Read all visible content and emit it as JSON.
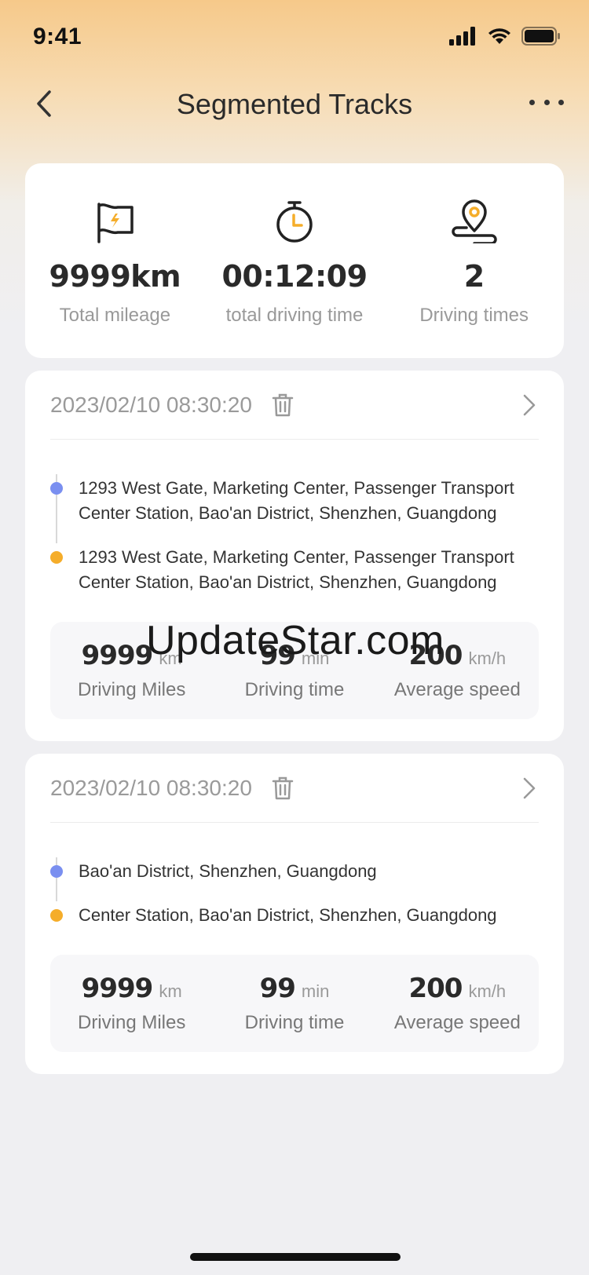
{
  "status": {
    "time": "9:41"
  },
  "nav": {
    "title": "Segmented Tracks"
  },
  "summary": [
    {
      "icon": "flag-icon",
      "value": "9999km",
      "label": "Total mileage"
    },
    {
      "icon": "stopwatch-icon",
      "value": "00:12:09",
      "label": "total driving time"
    },
    {
      "icon": "location-pin-icon",
      "value": "2",
      "label": "Driving times"
    }
  ],
  "trips": [
    {
      "date": "2023/02/10 08:30:20",
      "start": "1293 West Gate, Marketing Center, Passenger Transport Center Station, Bao'an District, Shenzhen, Guangdong",
      "end": "1293 West Gate, Marketing Center, Passenger Transport Center Station, Bao'an District, Shenzhen, Guangdong",
      "stats": [
        {
          "value": "9999",
          "unit": "km",
          "label": "Driving Miles"
        },
        {
          "value": "99",
          "unit": "min",
          "label": "Driving time"
        },
        {
          "value": "200",
          "unit": "km/h",
          "label": "Average speed"
        }
      ]
    },
    {
      "date": "2023/02/10 08:30:20",
      "start": "Bao'an District, Shenzhen, Guangdong",
      "end": "Center Station, Bao'an District, Shenzhen, Guangdong",
      "stats": [
        {
          "value": "9999",
          "unit": "km",
          "label": "Driving Miles"
        },
        {
          "value": "99",
          "unit": "min",
          "label": "Driving time"
        },
        {
          "value": "200",
          "unit": "km/h",
          "label": "Average speed"
        }
      ]
    }
  ],
  "watermark": "UpdateStar.com",
  "colors": {
    "accent": "#f5ad2a",
    "start_dot": "#7a8ff0",
    "end_dot": "#f5ad2a",
    "header_gradient_top": "#f6c98a"
  }
}
